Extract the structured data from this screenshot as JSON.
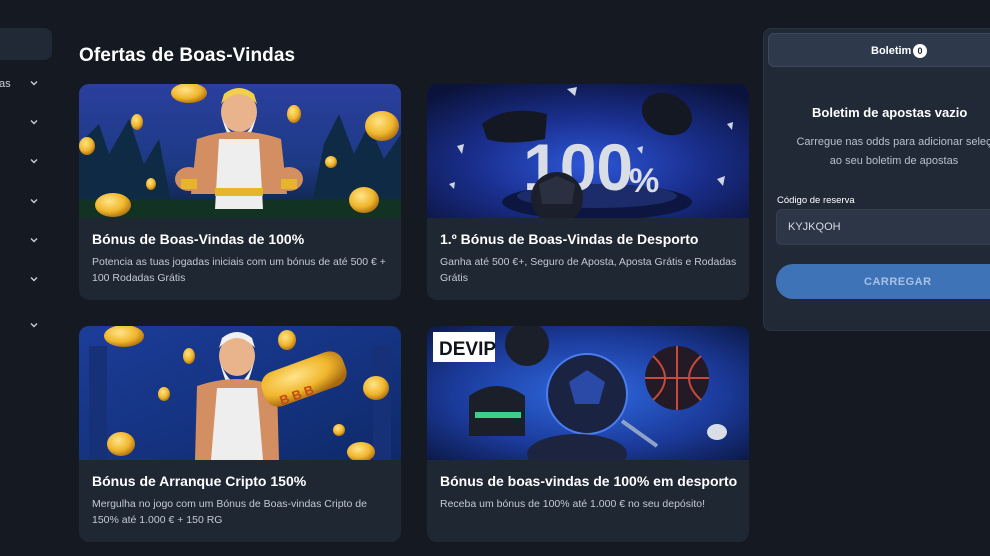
{
  "sidebar": {
    "items": [
      {
        "label_fragment": "as",
        "icon": "chevron-down-icon"
      },
      {
        "label_fragment": "",
        "icon": "chevron-down-icon"
      },
      {
        "label_fragment": "",
        "icon": "chevron-down-icon"
      },
      {
        "label_fragment": "",
        "icon": "chevron-down-icon"
      },
      {
        "label_fragment": "",
        "icon": "chevron-down-icon"
      },
      {
        "label_fragment": "",
        "icon": "chevron-down-icon"
      },
      {
        "label_fragment": "",
        "icon": "chevron-down-icon"
      }
    ]
  },
  "main": {
    "title": "Ofertas de Boas-Vindas",
    "offers": [
      {
        "title": "Bónus de Boas-Vindas de 100%",
        "description": "Potencia as tuas jogadas iniciais com um bónus de até 500 € + 100 Rodadas Grátis",
        "image": "zeus-coins-banner"
      },
      {
        "title": "1.º Bónus de Boas-Vindas de Desporto",
        "description": "Ganha até 500 €+, Seguro de Aposta, Aposta Grátis e Rodadas Grátis",
        "image": "sports-100-percent-banner",
        "image_text": "100",
        "image_text_suffix": "%"
      },
      {
        "title": "Bónus de Arranque Cripto 150%",
        "description": "Mergulha no jogo com um Bónus de Boas-vindas Cripto de 150% até 1.000 € + 150 RG",
        "image": "zeus-crypto-banner"
      },
      {
        "title": "Bónus de boas-vindas de 100% em desporto",
        "description": "Receba um bónus de 100% até 1.000 € no seu depósito!",
        "image": "devip-sports-banner",
        "image_badge": "DEVIP"
      }
    ]
  },
  "betslip": {
    "tab_label": "Boletim",
    "count": "0",
    "empty_title": "Boletim de apostas vazio",
    "empty_line1": "Carregue nas odds para adicionar seleç",
    "empty_line2": "ao seu boletim de apostas",
    "booking_label": "Código de reserva",
    "booking_value": "KYJKQOH",
    "load_button": "CARREGAR"
  },
  "colors": {
    "background": "#151a22",
    "card": "#1f2732",
    "panel": "#212936",
    "button": "#3e73b8"
  }
}
